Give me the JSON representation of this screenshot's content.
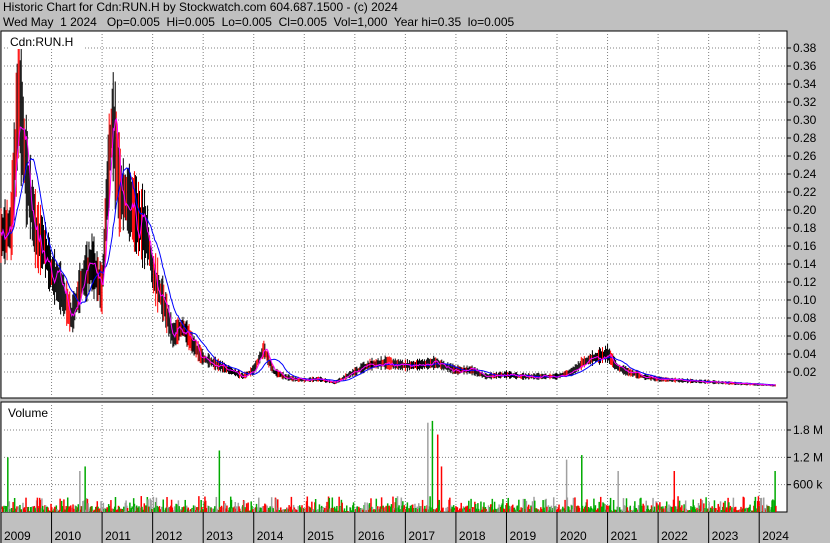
{
  "header": {
    "line1": "Historic Chart for Cdn:RUN.H by Stockwatch.com 604.687.1500 - (c) 2024",
    "line2": "Wed May  1 2024   Op=0.005  Hi=0.005  Lo=0.005  Cl=0.005  Vol=1,000  Year hi=0.35  lo=0.005"
  },
  "colors": {
    "background": "#c0c0c0",
    "panel": "#ffffff",
    "grid": "#808080",
    "price_bar": "#000000",
    "price_down": "#ff0000",
    "ma_short": "#ff00ff",
    "ma_long": "#0000ff",
    "vol_up": "#00aa00",
    "vol_down": "#ff0000",
    "vol_flat": "#a0a0a0"
  },
  "chart_data": [
    {
      "type": "line",
      "title": "Cdn:RUN.H",
      "ylim": [
        0,
        0.39
      ],
      "y_ticks": [
        "0.38",
        "0.36",
        "0.34",
        "0.32",
        "0.30",
        "0.28",
        "0.26",
        "0.24",
        "0.22",
        "0.20",
        "0.18",
        "0.16",
        "0.14",
        "0.12",
        "0.10",
        "0.08",
        "0.06",
        "0.04",
        "0.02"
      ],
      "x_ticks": [
        "2009",
        "2010",
        "2011",
        "2012",
        "2013",
        "2014",
        "2015",
        "2016",
        "2017",
        "2018",
        "2019",
        "2020",
        "2021",
        "2022",
        "2023",
        "2024"
      ],
      "grid": true,
      "series": [
        {
          "x": [
            2009.0,
            2009.2,
            2009.35,
            2009.5,
            2009.7,
            2009.85,
            2010.0,
            2010.2,
            2010.4,
            2010.6,
            2010.8,
            2011.0,
            2011.1,
            2011.2,
            2011.35,
            2011.5,
            2011.7,
            2011.9,
            2012.0,
            2012.2,
            2012.4,
            2012.6,
            2012.8,
            2013.0,
            2013.2,
            2013.4,
            2013.6,
            2013.8,
            2014.0,
            2014.2,
            2014.4,
            2014.6,
            2014.8,
            2015.0,
            2015.3,
            2015.6,
            2016.0,
            2016.3,
            2016.6,
            2017.0,
            2017.3,
            2017.6,
            2018.0,
            2018.3,
            2018.6,
            2019.0,
            2019.3,
            2019.6,
            2020.0,
            2020.3,
            2020.5,
            2020.7,
            2021.0,
            2021.2,
            2021.4,
            2021.7,
            2022.0,
            2022.3,
            2022.6,
            2023.0,
            2023.3,
            2023.6,
            2024.0,
            2024.3
          ],
          "values": [
            0.17,
            0.18,
            0.33,
            0.24,
            0.17,
            0.16,
            0.13,
            0.11,
            0.08,
            0.12,
            0.14,
            0.11,
            0.22,
            0.3,
            0.22,
            0.21,
            0.19,
            0.17,
            0.13,
            0.1,
            0.06,
            0.07,
            0.05,
            0.035,
            0.03,
            0.025,
            0.02,
            0.015,
            0.022,
            0.045,
            0.02,
            0.015,
            0.012,
            0.011,
            0.012,
            0.008,
            0.02,
            0.028,
            0.03,
            0.027,
            0.028,
            0.03,
            0.022,
            0.022,
            0.015,
            0.017,
            0.015,
            0.015,
            0.015,
            0.02,
            0.03,
            0.035,
            0.04,
            0.025,
            0.02,
            0.015,
            0.012,
            0.011,
            0.01,
            0.009,
            0.008,
            0.007,
            0.006,
            0.005
          ]
        }
      ]
    },
    {
      "type": "bar",
      "title": "Volume",
      "y_ticks": [
        "1.8 M",
        "1.2 M",
        "600 k"
      ],
      "ylim": [
        0,
        2200000
      ]
    }
  ]
}
